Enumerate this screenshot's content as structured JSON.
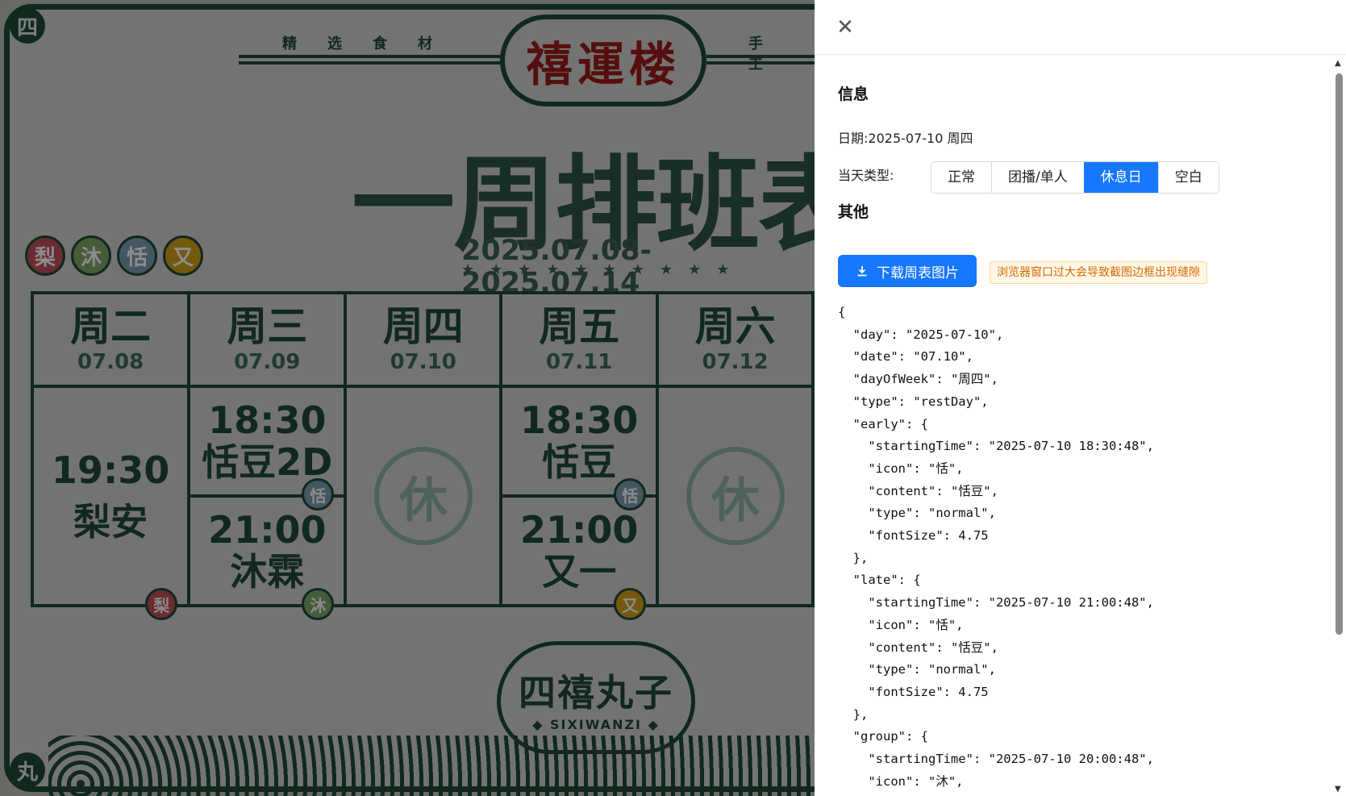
{
  "poster": {
    "corner_tl": "四",
    "corner_bl": "丸",
    "slogan_left": "精选食材",
    "slogan_right": "手工",
    "brand": "禧運楼",
    "title": "一周排班表",
    "date_range": "2025.07.08-2025.07.14",
    "stars": "★★★★★★★★★★",
    "members": [
      {
        "char": "梨",
        "color": "#c0505a"
      },
      {
        "char": "沐",
        "color": "#7fa86a"
      },
      {
        "char": "恬",
        "color": "#7c9fb1"
      },
      {
        "char": "又",
        "color": "#d4a017"
      }
    ],
    "days": [
      {
        "name": "周二",
        "date": "07.08"
      },
      {
        "name": "周三",
        "date": "07.09"
      },
      {
        "name": "周四",
        "date": "07.10"
      },
      {
        "name": "周五",
        "date": "07.11"
      },
      {
        "name": "周六",
        "date": "07.12"
      }
    ],
    "slots": {
      "tue_time": "19:30",
      "tue_name": "梨安",
      "tue_badge": "梨",
      "wed_early_time": "18:30",
      "wed_early_name": "恬豆2D",
      "wed_early_badge": "恬",
      "wed_late_time": "21:00",
      "wed_late_name": "沐霖",
      "wed_late_badge": "沐",
      "thu_rest": "休",
      "fri_early_time": "18:30",
      "fri_early_name": "恬豆",
      "fri_early_badge": "恬",
      "fri_late_time": "21:00",
      "fri_late_name": "又一",
      "fri_late_badge": "又",
      "sat_rest": "休"
    },
    "logo_main": "四禧丸子",
    "logo_sub": "◆ SIXIWANZI ◆"
  },
  "drawer": {
    "info_title": "信息",
    "date_label": "日期:",
    "date_value": "2025-07-10 周四",
    "type_label": "当天类型:",
    "type_options": [
      "正常",
      "团播/单人",
      "休息日",
      "空白"
    ],
    "type_selected": "休息日",
    "other_title": "其他",
    "download_label": "下载周表图片",
    "warning": "浏览器窗口过大会导致截图边框出现缝隙",
    "json_text": "{\n  \"day\": \"2025-07-10\",\n  \"date\": \"07.10\",\n  \"dayOfWeek\": \"周四\",\n  \"type\": \"restDay\",\n  \"early\": {\n    \"startingTime\": \"2025-07-10 18:30:48\",\n    \"icon\": \"恬\",\n    \"content\": \"恬豆\",\n    \"type\": \"normal\",\n    \"fontSize\": 4.75\n  },\n  \"late\": {\n    \"startingTime\": \"2025-07-10 21:00:48\",\n    \"icon\": \"恬\",\n    \"content\": \"恬豆\",\n    \"type\": \"normal\",\n    \"fontSize\": 4.75\n  },\n  \"group\": {\n    \"startingTime\": \"2025-07-10 20:00:48\",\n    \"icon\": \"沐\","
  },
  "colors": {
    "accent": "#1677ff",
    "poster_green": "#1f4a3b",
    "brand_red": "#9b1b1b",
    "warning_text": "#d46b08"
  }
}
